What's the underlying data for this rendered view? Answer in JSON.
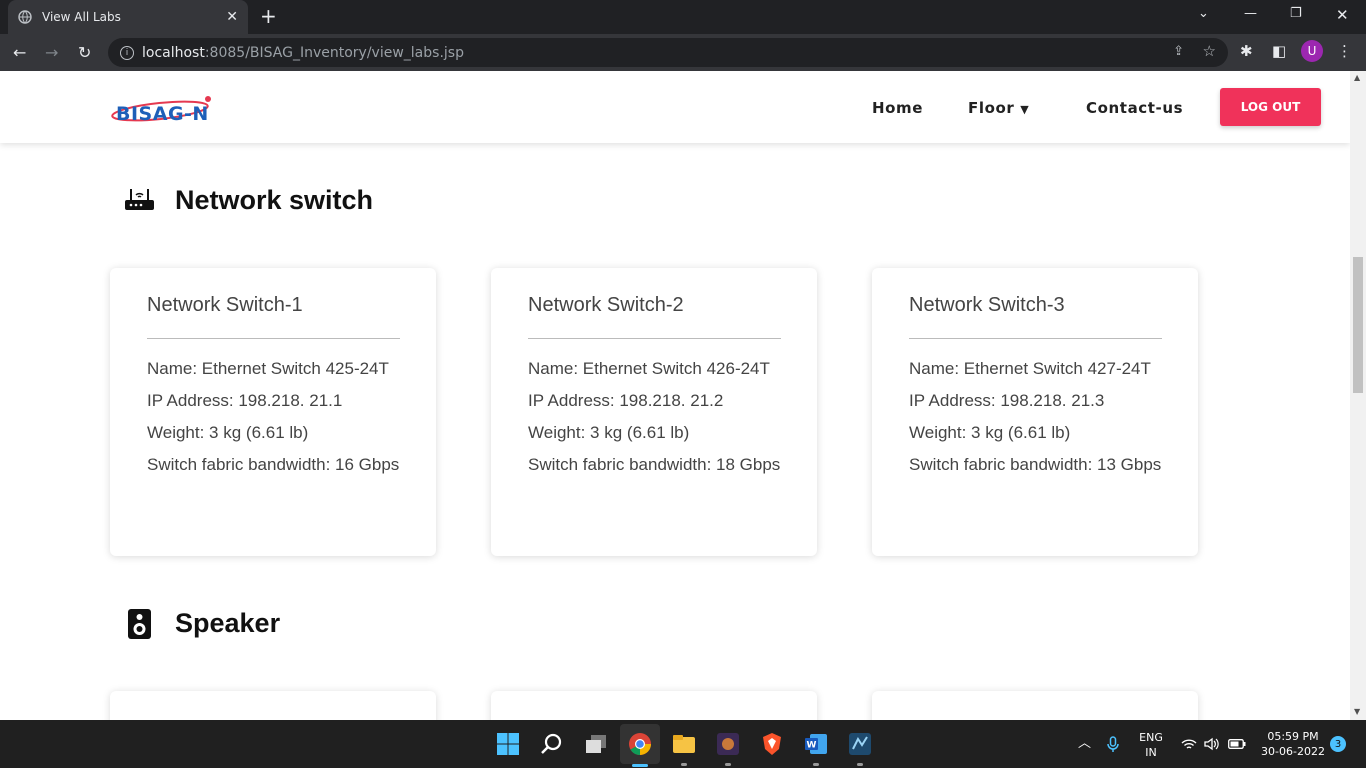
{
  "browser": {
    "tab_title": "View All Labs",
    "url_host": "localhost",
    "url_path": ":8085/BISAG_Inventory/view_labs.jsp",
    "avatar_letter": "U"
  },
  "navbar": {
    "logo_text": "BISAG-N",
    "home": "Home",
    "floor": "Floor",
    "contact": "Contact-us",
    "logout": "LOG OUT"
  },
  "sections": {
    "network": {
      "title": "Network switch",
      "cards": [
        {
          "title": "Network Switch-1",
          "name": "Name: Ethernet Switch 425-24T",
          "ip": "IP Address: 198.218. 21.1",
          "weight": "Weight: 3 kg (6.61 lb)",
          "bandwidth": "Switch fabric bandwidth: 16 Gbps"
        },
        {
          "title": "Network Switch-2",
          "name": "Name: Ethernet Switch 426-24T",
          "ip": "IP Address: 198.218. 21.2",
          "weight": "Weight: 3 kg (6.61 lb)",
          "bandwidth": "Switch fabric bandwidth: 18 Gbps"
        },
        {
          "title": "Network Switch-3",
          "name": "Name: Ethernet Switch 427-24T",
          "ip": "IP Address: 198.218. 21.3",
          "weight": "Weight: 3 kg (6.61 lb)",
          "bandwidth": "Switch fabric bandwidth: 13 Gbps"
        }
      ]
    },
    "speaker": {
      "title": "Speaker"
    }
  },
  "taskbar": {
    "lang_top": "ENG",
    "lang_bottom": "IN",
    "time": "05:59 PM",
    "date": "30-06-2022",
    "notif_count": "3"
  },
  "colors": {
    "accent": "#f0325a",
    "logo_blue": "#1d5fb8"
  }
}
